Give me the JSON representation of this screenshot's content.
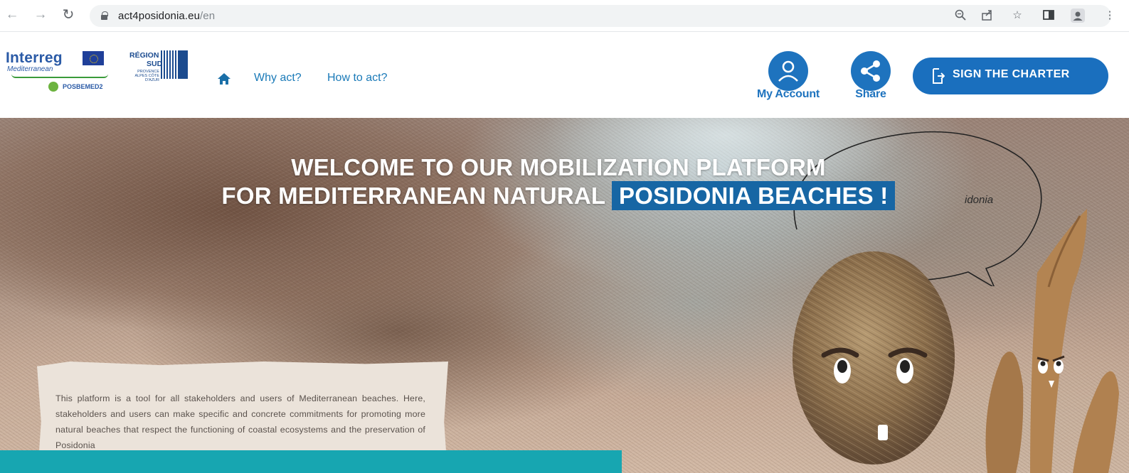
{
  "browser": {
    "url_host": "act4posidonia.eu",
    "url_path": "/en",
    "icons": [
      "back-arrow-icon",
      "forward-arrow-icon",
      "reload-icon",
      "lock-icon",
      "zoom-icon",
      "share-page-icon",
      "bookmark-star-icon",
      "side-panel-icon",
      "profile-icon",
      "kebab-menu-icon"
    ]
  },
  "header": {
    "logo_interreg": {
      "word": "Interreg",
      "sub": "Mediterranean",
      "project": "POSBEMED2"
    },
    "logo_region": {
      "line1": "RÉGION",
      "line2": "SUD",
      "tagline": "PROVENCE ALPES CÔTE D'AZUR"
    },
    "nav": {
      "home_icon": "home-icon",
      "why": "Why act?",
      "how": "How to act?"
    },
    "account_label": "My Account",
    "share_label": "Share",
    "sign_label": "SIGN THE CHARTER",
    "colors": {
      "brand_blue": "#1e73be",
      "sign_button": "#1a6fbe",
      "link": "#1a7ab8"
    }
  },
  "hero": {
    "headline_line1": "WELCOME TO OUR MOBILIZATION PLATFORM",
    "headline_line2_plain": "FOR MEDITERRANEAN NATURAL ",
    "headline_line2_highlight": "POSIDONIA BEACHES !",
    "bubble_text": "idonia",
    "intro": "This platform is a tool for all stakeholders and users of Mediterranean beaches. Here, stakeholders and users can make specific and concrete commitments for promoting more natural beaches that respect the functioning of coastal ecosystems and the preservation of Posidonia",
    "colors": {
      "highlight": "#1766a4",
      "banner": "#17a6b1"
    }
  }
}
